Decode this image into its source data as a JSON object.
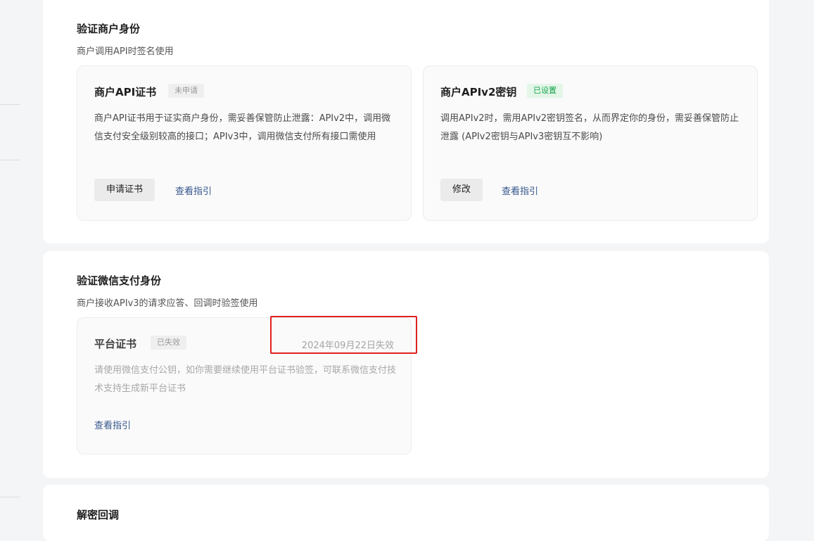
{
  "verify_merchant": {
    "title": "验证商户身份",
    "subtitle": "商户调用API时签名使用",
    "api_cert_card": {
      "title": "商户API证书",
      "badge": "未申请",
      "description": "商户API证书用于证实商户身份，需妥善保管防止泄露：APIv2中，调用微信支付安全级别较高的接口；APIv3中，调用微信支付所有接口需使用",
      "apply_button": "申请证书",
      "guide_link": "查看指引"
    },
    "apiv2_key_card": {
      "title": "商户APIv2密钥",
      "badge": "已设置",
      "description": "调用APIv2时，需用APIv2密钥签名，从而界定你的身份，需妥善保管防止泄露 (APIv2密钥与APIv3密钥互不影响)",
      "modify_button": "修改",
      "guide_link": "查看指引"
    }
  },
  "verify_wechatpay": {
    "title": "验证微信支付身份",
    "subtitle": "商户接收APIv3的请求应答、回调时验签使用",
    "platform_cert_card": {
      "title": "平台证书",
      "badge": "已失效",
      "expiry": "2024年09月22日失效",
      "description": "请使用微信支付公钥，如你需要继续使用平台证书验签，可联系微信支付技术支持生成新平台证书",
      "guide_link": "查看指引"
    }
  },
  "decrypt_callback": {
    "title": "解密回调"
  },
  "colors": {
    "highlight_border": "#e02020",
    "link": "#35568c",
    "success_badge": "#15a34a"
  }
}
